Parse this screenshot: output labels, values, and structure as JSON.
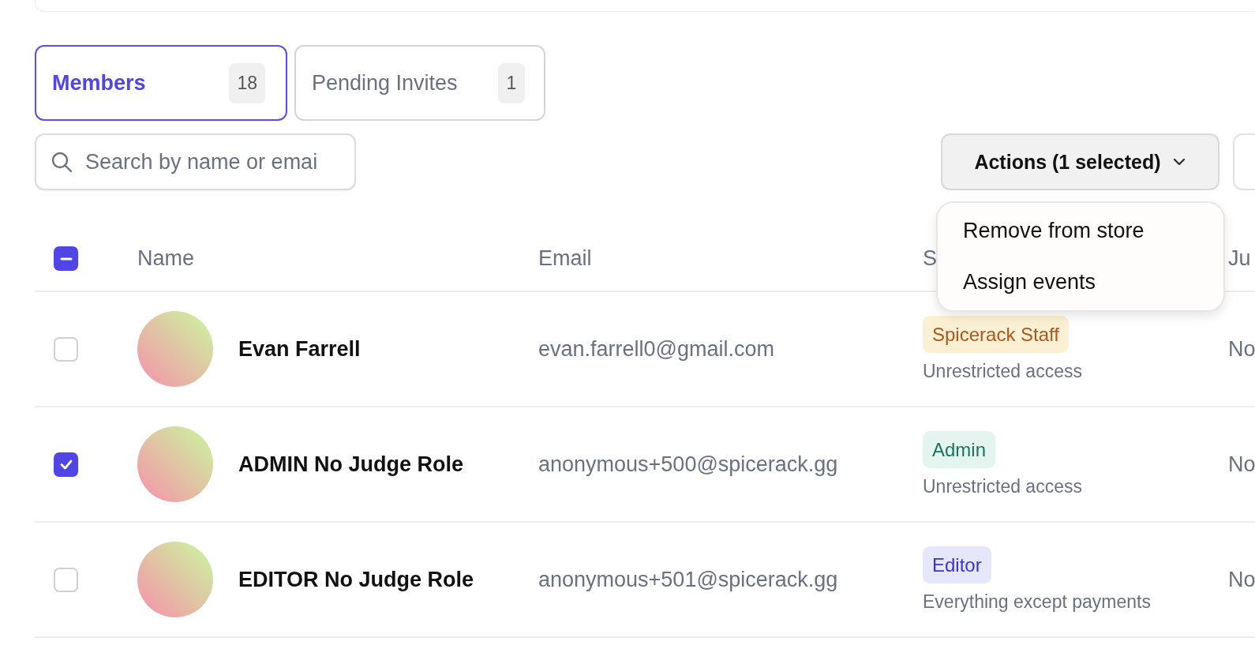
{
  "tabs": [
    {
      "label": "Members",
      "count": "18",
      "selected": true
    },
    {
      "label": "Pending Invites",
      "count": "1",
      "selected": false
    }
  ],
  "search": {
    "placeholder": "Search by name or emai"
  },
  "actions_button": {
    "label": "Actions (1 selected)",
    "expanded": true
  },
  "actions_menu": {
    "items": [
      "Remove from store",
      "Assign events"
    ]
  },
  "table": {
    "select_all": {
      "indeterminate": true
    },
    "columns": [
      "Name",
      "Email",
      "S",
      "Ju"
    ],
    "rows": [
      {
        "selected": false,
        "name": "Evan Farrell",
        "email": "evan.farrell0@gmail.com",
        "role": {
          "label": "Spicerack Staff",
          "kind": "staff"
        },
        "access": "Unrestricted access",
        "column_4": "No"
      },
      {
        "selected": true,
        "name": "ADMIN No Judge Role",
        "email": "anonymous+500@spicerack.gg",
        "role": {
          "label": "Admin",
          "kind": "admin"
        },
        "access": "Unrestricted access",
        "column_4": "No"
      },
      {
        "selected": false,
        "name": "EDITOR No Judge Role",
        "email": "anonymous+501@spicerack.gg",
        "role": {
          "label": "Editor",
          "kind": "editor"
        },
        "access": "Everything except payments",
        "column_4": "No"
      }
    ]
  }
}
